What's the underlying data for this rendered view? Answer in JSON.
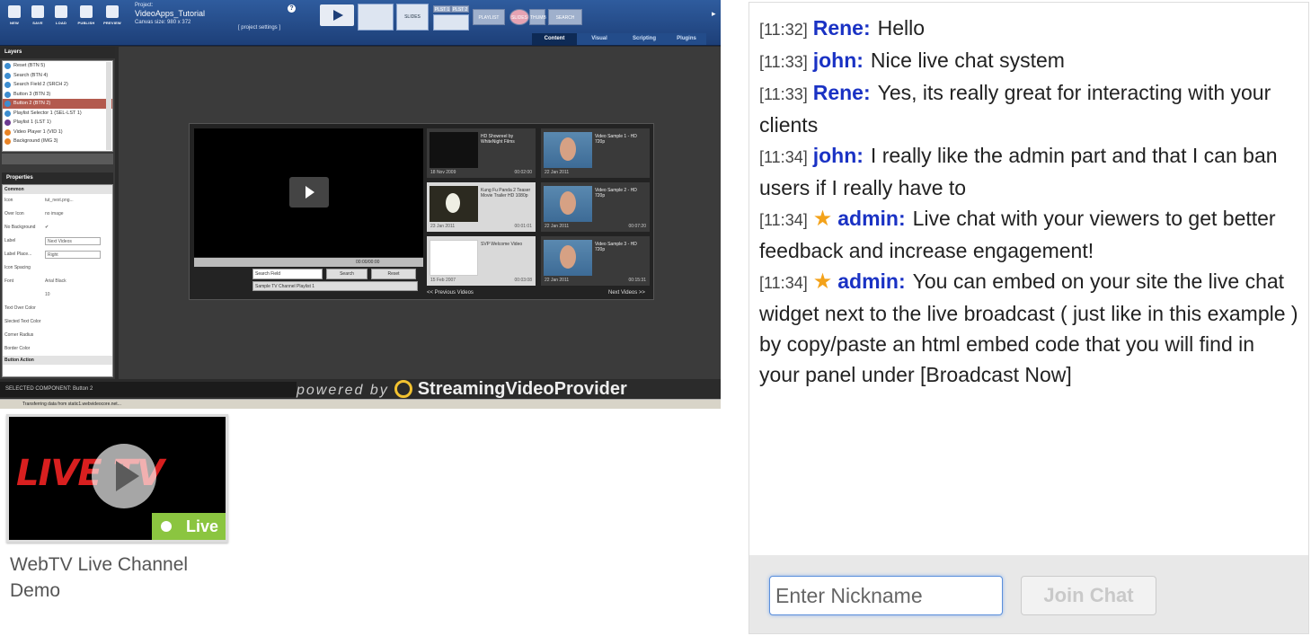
{
  "editor": {
    "toolbar": {
      "buttons": [
        "NEW",
        "SAVE",
        "LOAD",
        "PUBLISH",
        "PREVIEW"
      ],
      "project_label": "Project:",
      "project_name": "VideoApps_Tutorial",
      "canvas_size": "Canvas size: 980 x 372",
      "project_settings": "[ project settings ]",
      "help": "?",
      "tool_slides": "SLIDES",
      "tool_pl1": "PLST 1",
      "tool_pl2": "PLST 2",
      "tool_playlist": "PLAYLIST",
      "tool_slides2": "SLIDES",
      "tool_thumbs": "THUMB",
      "tool_search": "SEARCH",
      "tabs": [
        "Content",
        "Visual",
        "Scripting",
        "Plugins"
      ]
    },
    "layers": {
      "title": "Layers",
      "items": [
        "Reset (BTN 5)",
        "Search (BTN 4)",
        "Search Field 2 (SRCH 2)",
        "Button 3 (BTN 3)",
        "Button 2 (BTN 2)",
        "Playlist Selector 1 (SEL-LST 1)",
        "Playlist 1 (LST 1)",
        "Video Player 1 (VID 1)",
        "Background (IMG 3)"
      ]
    },
    "properties": {
      "title": "Properties",
      "section_common": "Common",
      "rows": [
        {
          "label": "Icon",
          "value": "tut_next.png..."
        },
        {
          "label": "Over Icon",
          "value": "no image"
        },
        {
          "label": "No Background",
          "value": "✔"
        },
        {
          "label": "Label",
          "value": "Next Videos"
        },
        {
          "label": "Label Place...",
          "value": "Right"
        },
        {
          "label": "Icon Spacing",
          "value": ""
        },
        {
          "label": "Font",
          "value": "Arial Black"
        },
        {
          "label": "",
          "value": "10"
        },
        {
          "label": "Text Over Color",
          "value": ""
        },
        {
          "label": "Slected Text Color",
          "value": ""
        },
        {
          "label": "Corner Radius",
          "value": ""
        },
        {
          "label": "Border Color",
          "value": ""
        }
      ],
      "section_action": "Button Action"
    },
    "player": {
      "time": "00:00/00:00",
      "search_placeholder": "Search Field",
      "search_button": "Search",
      "reset_button": "Reset",
      "playlist_select": "Sample TV Channel Playlist 1",
      "videos": [
        {
          "title": "HD Showreel by WhiteNight Films",
          "date": "18 Nov 2009",
          "duration": "00:02:00"
        },
        {
          "title": "Video Sample 1 - HD 720p",
          "date": "22 Jan 2011",
          "duration": ""
        },
        {
          "title": "Kung Fu Panda 2 Teaser Movie Trailer HD 1080p",
          "date": "23 Jan 2011",
          "duration": "00:01:01"
        },
        {
          "title": "Video Sample 2 - HD 720p",
          "date": "22 Jan 2011",
          "duration": "00:07:20"
        },
        {
          "title": "SVP Welcome Video",
          "date": "15 Feb 2007",
          "duration": "00:03:08"
        },
        {
          "title": "Video Sample 3 - HD 720p",
          "date": "22 Jan 2011",
          "duration": "00:15:31"
        }
      ],
      "prev": "<< Previous Videos",
      "next": "Next Videos >>"
    },
    "selected_component": "SELECTED COMPONENT:  Button 2",
    "brand_powered": "powered by",
    "brand_name": "StreamingVideoProvider",
    "status": "Transferring data from static1.webvideocore.net..."
  },
  "channel": {
    "thumb_brand": "LIVE TV",
    "live_badge": "Live",
    "name": "WebTV Live Channel Demo"
  },
  "chat": {
    "messages": [
      {
        "time": "[11:32]",
        "user": "Rene:",
        "text": "Hello",
        "admin": false
      },
      {
        "time": "[11:33]",
        "user": "john:",
        "text": "Nice live chat system",
        "admin": false
      },
      {
        "time": "[11:33]",
        "user": "Rene:",
        "text": "Yes, its really great for interacting with your clients",
        "admin": false
      },
      {
        "time": "[11:34]",
        "user": "john:",
        "text": "I really like the admin part and that I can ban users if I really have to",
        "admin": false
      },
      {
        "time": "[11:34]",
        "user": "admin:",
        "text": "Live chat with your viewers to get better feedback and increase engagement!",
        "admin": true
      },
      {
        "time": "[11:34]",
        "user": "admin:",
        "text": "You can embed on your site the live chat widget next to the live broadcast ( just like in this example ) by copy/paste an html embed code that you will find in your panel under [Broadcast Now]",
        "admin": true
      }
    ],
    "nickname_placeholder": "Enter Nickname",
    "join_label": "Join Chat",
    "admin_icon": "star-icon",
    "colors": {
      "username": "#1a32c4",
      "star": "#f3a21a",
      "live": "#8bc540"
    }
  }
}
